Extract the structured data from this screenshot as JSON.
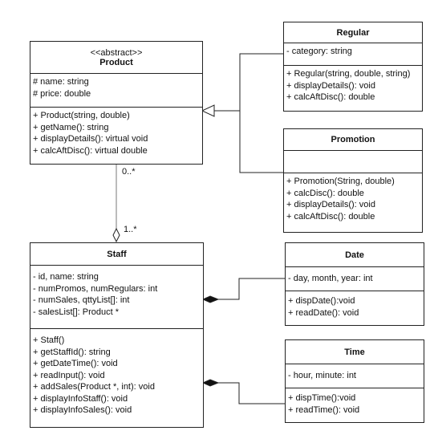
{
  "classes": {
    "product": {
      "stereotype": "<<abstract>>",
      "name": "Product",
      "attributes": [
        "# name: string",
        "# price: double"
      ],
      "methods": [
        "+ Product(string, double)",
        "+ getName(): string",
        "+ displayDetails(): virtual void",
        "+ calcAftDisc(): virtual double"
      ]
    },
    "regular": {
      "name": "Regular",
      "attributes": [
        "- category: string"
      ],
      "methods": [
        "+ Regular(string, double, string)",
        "+ displayDetails(): void",
        "+ calcAftDisc(): double"
      ]
    },
    "promotion": {
      "name": "Promotion",
      "attributes": [],
      "methods": [
        "+ Promotion(String, double)",
        "+ calcDisc(): double",
        "+ displayDetails(): void",
        "+ calcAftDisc(): double"
      ]
    },
    "staff": {
      "name": "Staff",
      "attributes": [
        "- id, name: string",
        "- numPromos, numRegulars: int",
        "- numSales, qttyList[]: int",
        "- salesList[]: Product *"
      ],
      "methods": [
        "+ Staff()",
        "+ getStaffId(): string",
        "+ getDateTime(): void",
        "+ readInput(): void",
        "+ addSales(Product *, int): void",
        "+ displayInfoStaff(): void",
        "+ displayInfoSales(): void"
      ]
    },
    "date": {
      "name": "Date",
      "attributes": [
        "- day, month, year: int"
      ],
      "methods": [
        "+ dispDate():void",
        "+ readDate(): void"
      ]
    },
    "time": {
      "name": "Time",
      "attributes": [
        "- hour, minute: int"
      ],
      "methods": [
        "+ dispTime():void",
        "+ readTime(): void"
      ]
    }
  },
  "relations": {
    "aggregation": {
      "product_multiplicity": "0..*",
      "staff_multiplicity": "1..*"
    },
    "generalization": "Regular, Promotion -> Product",
    "composition": "Date, Time -> Staff"
  }
}
